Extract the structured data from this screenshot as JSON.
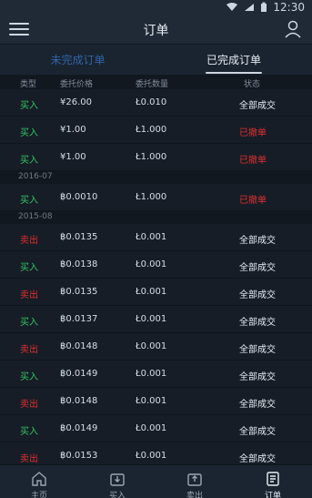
{
  "status_bar": {
    "time": "12:30"
  },
  "top_bar": {
    "title": "订单"
  },
  "tabs": [
    {
      "label": "未完成订单",
      "active": false
    },
    {
      "label": "已完成订单",
      "active": true
    }
  ],
  "columns": [
    "类型",
    "委托价格",
    "委托数量",
    "状态"
  ],
  "rows_section1": [
    {
      "type": "买入",
      "price": "¥26.00",
      "qty": "Ł0.010",
      "status": "全部成交"
    },
    {
      "type": "买入",
      "price": "¥1.00",
      "qty": "Ł1.000",
      "status": "已撤单"
    },
    {
      "type": "买入",
      "price": "¥1.00",
      "qty": "Ł1.000",
      "status": "已撤单"
    }
  ],
  "section_2016": "2016-07",
  "rows_section2": [
    {
      "type": "买入",
      "price": "฿0.0010",
      "qty": "Ł1.000",
      "status": "已撤单"
    }
  ],
  "section_2015": "2015-08",
  "rows_section3": [
    {
      "type": "卖出",
      "price": "฿0.0135",
      "qty": "Ł0.001",
      "status": "全部成交"
    },
    {
      "type": "买入",
      "price": "฿0.0138",
      "qty": "Ł0.001",
      "status": "全部成交"
    },
    {
      "type": "卖出",
      "price": "฿0.0135",
      "qty": "Ł0.001",
      "status": "全部成交"
    },
    {
      "type": "买入",
      "price": "฿0.0137",
      "qty": "Ł0.001",
      "status": "全部成交"
    },
    {
      "type": "卖出",
      "price": "฿0.0148",
      "qty": "Ł0.001",
      "status": "全部成交"
    },
    {
      "type": "买入",
      "price": "฿0.0149",
      "qty": "Ł0.001",
      "status": "全部成交"
    },
    {
      "type": "卖出",
      "price": "฿0.0148",
      "qty": "Ł0.001",
      "status": "全部成交"
    },
    {
      "type": "买入",
      "price": "฿0.0149",
      "qty": "Ł0.001",
      "status": "全部成交"
    },
    {
      "type": "卖出",
      "price": "฿0.0153",
      "qty": "Ł0.001",
      "status": "全部成交"
    }
  ],
  "bottom_nav": [
    {
      "label": "主页",
      "active": false
    },
    {
      "label": "买入",
      "active": false
    },
    {
      "label": "卖出",
      "active": false
    },
    {
      "label": "订单",
      "active": true
    }
  ]
}
